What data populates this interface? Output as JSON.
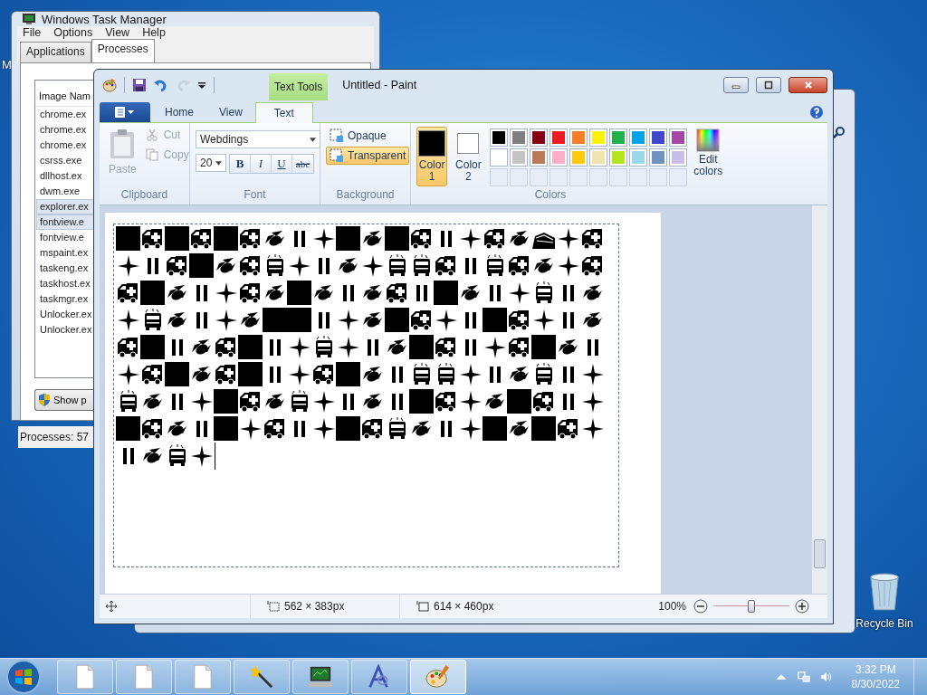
{
  "desktop": {
    "icon_label": "M",
    "recycle_bin": "Recycle Bin"
  },
  "task_manager": {
    "title": "Windows Task Manager",
    "menu": [
      "File",
      "Options",
      "View",
      "Help"
    ],
    "tabs": [
      {
        "label": "Applications",
        "selected": false
      },
      {
        "label": "Processes",
        "selected": true
      }
    ],
    "column": "Image Nam",
    "rows": [
      {
        "name": "chrome.ex",
        "selected": false
      },
      {
        "name": "chrome.ex",
        "selected": false
      },
      {
        "name": "chrome.ex",
        "selected": false
      },
      {
        "name": "csrss.exe",
        "selected": false
      },
      {
        "name": "dllhost.ex",
        "selected": false
      },
      {
        "name": "dwm.exe",
        "selected": false
      },
      {
        "name": "explorer.ex",
        "selected": true
      },
      {
        "name": "fontview.e",
        "selected": true
      },
      {
        "name": "fontview.e",
        "selected": false
      },
      {
        "name": "mspaint.ex",
        "selected": false
      },
      {
        "name": "taskeng.ex",
        "selected": false
      },
      {
        "name": "taskhost.ex",
        "selected": false
      },
      {
        "name": "taskmgr.ex",
        "selected": false
      },
      {
        "name": "Unlocker.ex",
        "selected": false
      },
      {
        "name": "Unlocker.ex",
        "selected": false
      }
    ],
    "button": "Show p",
    "status": "Processes: 57"
  },
  "paint": {
    "title": "Untitled - Paint",
    "context_label": "Text Tools",
    "tabs": [
      {
        "label": "Home",
        "selected": false
      },
      {
        "label": "View",
        "selected": false
      },
      {
        "label": "Text",
        "selected": true
      }
    ],
    "clipboard": {
      "paste": "Paste",
      "cut": "Cut",
      "copy": "Copy",
      "label": "Clipboard",
      "disabled": true
    },
    "font": {
      "family": "Webdings",
      "size": "20",
      "styles": [
        {
          "label": "B",
          "kind": "bold"
        },
        {
          "label": "I",
          "kind": "italic"
        },
        {
          "label": "U",
          "kind": "underline"
        },
        {
          "label": "abc",
          "kind": "strike"
        }
      ],
      "label": "Font"
    },
    "background": {
      "options": [
        {
          "label": "Opaque",
          "selected": false
        },
        {
          "label": "Transparent",
          "selected": true
        }
      ],
      "label": "Background"
    },
    "colors": {
      "slots": [
        {
          "label": "Color",
          "index": "1",
          "color": "#000000",
          "selected": true
        },
        {
          "label": "Color",
          "index": "2",
          "color": "#ffffff",
          "selected": false
        }
      ],
      "palette": [
        {
          "color": "#000000"
        },
        {
          "color": "#7f7f7f"
        },
        {
          "color": "#880015"
        },
        {
          "color": "#ed1c24"
        },
        {
          "color": "#ff7f27"
        },
        {
          "color": "#fff200"
        },
        {
          "color": "#22b14c"
        },
        {
          "color": "#00a2e8"
        },
        {
          "color": "#3f48cc"
        },
        {
          "color": "#a349a4"
        },
        {
          "color": "#ffffff"
        },
        {
          "color": "#c3c3c3"
        },
        {
          "color": "#b97a57"
        },
        {
          "color": "#ffaec9"
        },
        {
          "color": "#ffc90e"
        },
        {
          "color": "#efe4b0"
        },
        {
          "color": "#b5e61d"
        },
        {
          "color": "#99d9ea"
        },
        {
          "color": "#7092be"
        },
        {
          "color": "#c8bfe7"
        }
      ],
      "edit": "Edit colors",
      "label": "Colors"
    },
    "status": {
      "selection": "562 × 383px",
      "size": "614 × 460px",
      "zoom": "100%",
      "zoom_slider": {
        "level": 0.5
      }
    }
  },
  "taskbar": {
    "apps": [
      {
        "kind": "file",
        "selected": false
      },
      {
        "kind": "file",
        "selected": false
      },
      {
        "kind": "file",
        "selected": false
      },
      {
        "kind": "wand",
        "selected": false
      },
      {
        "kind": "monitor",
        "selected": false
      },
      {
        "kind": "font",
        "selected": false
      },
      {
        "kind": "palette",
        "selected": true
      }
    ],
    "time": "3:32 PM",
    "date": "8/30/2022"
  }
}
